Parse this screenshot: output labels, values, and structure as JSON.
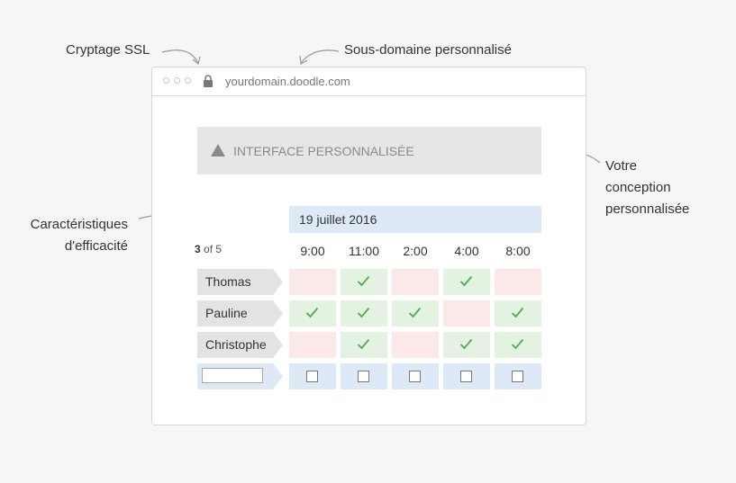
{
  "callouts": {
    "ssl": "Cryptage SSL",
    "subdomain": "Sous-domaine personnalisé",
    "design_line1": "Votre",
    "design_line2": "conception",
    "design_line3": "personnalisée",
    "efficiency_line1": "Caractéristiques",
    "efficiency_line2": "d'efficacité"
  },
  "browser": {
    "url": "yourdomain.doodle.com"
  },
  "banner": {
    "icon": "triangle-logo-icon",
    "text": "INTERFACE PERSONNALISÉE"
  },
  "poll": {
    "date": "19 juillet 2016",
    "counter_current": "3",
    "counter_rest": " of 5",
    "times": [
      "9:00",
      "11:00",
      "2:00",
      "4:00",
      "8:00"
    ],
    "participants": [
      {
        "name": "Thomas",
        "votes": [
          "no",
          "yes",
          "no",
          "yes",
          "no"
        ]
      },
      {
        "name": "Pauline",
        "votes": [
          "yes",
          "yes",
          "yes",
          "no",
          "yes"
        ]
      },
      {
        "name": "Christophe",
        "votes": [
          "no",
          "yes",
          "no",
          "yes",
          "yes"
        ]
      }
    ],
    "new_row_placeholder": ""
  },
  "colors": {
    "yes": "#e3f2e1",
    "no": "#fae9e7",
    "blank": "#dde9f7",
    "check": "#4caf50"
  }
}
